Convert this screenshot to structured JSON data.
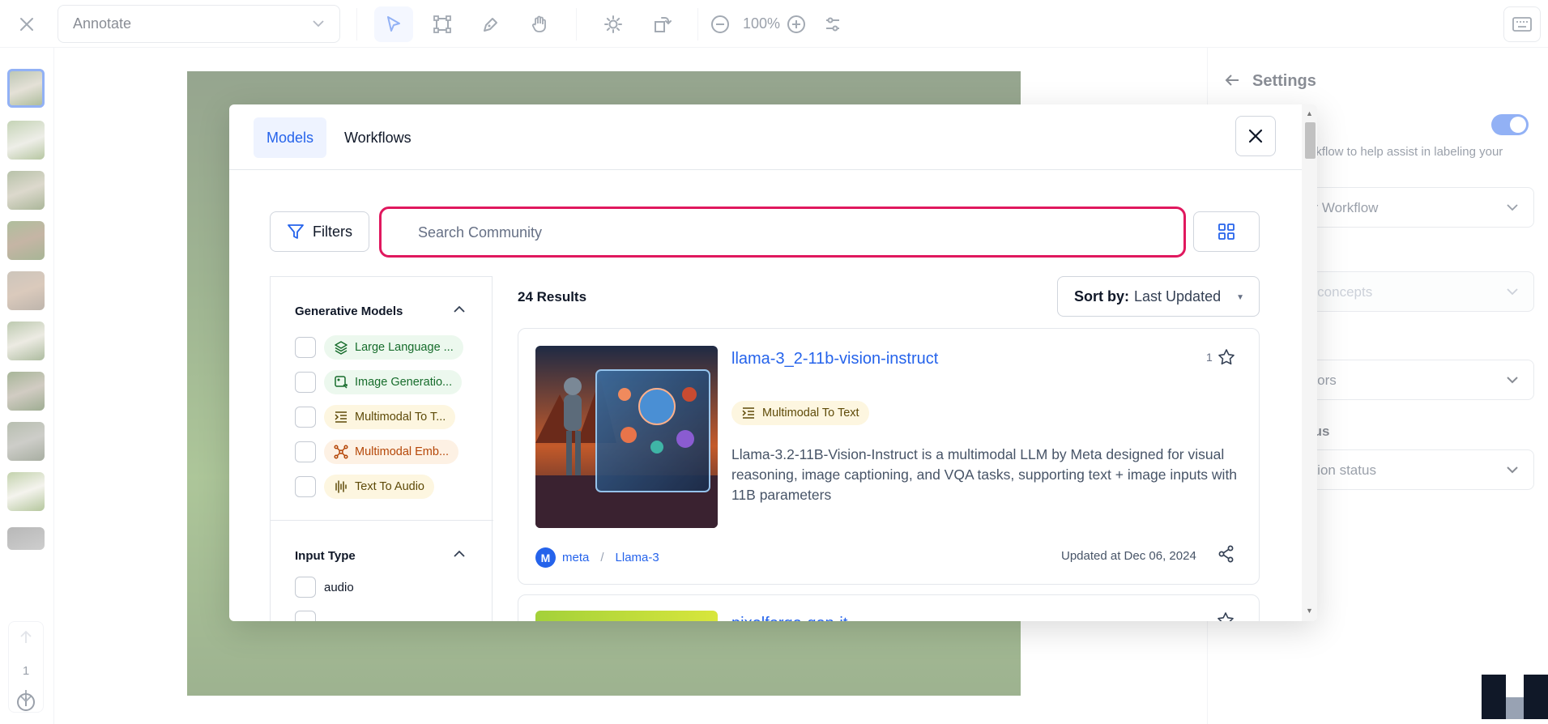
{
  "toolbar": {
    "mode_label": "Annotate",
    "zoom_level": "100%"
  },
  "leftbar": {
    "page_number": "1"
  },
  "settings": {
    "title": "Settings",
    "description": "orkflow to help assist in labeling your",
    "model_select": "or Workflow",
    "concepts_select": "d concepts",
    "annotators_select": "ators",
    "status_label": "tus",
    "status_select": "ation status"
  },
  "modal": {
    "tabs": [
      {
        "label": "Models",
        "active": true
      },
      {
        "label": "Workflows",
        "active": false
      }
    ],
    "filters_label": "Filters",
    "search": {
      "placeholder": "Search Community",
      "value": ""
    },
    "results_count": "24 Results",
    "sort": {
      "prefix": "Sort by:",
      "value": "Last Updated"
    },
    "filter_sections": [
      {
        "title": "Generative Models",
        "items": [
          {
            "label": "Large Language ...",
            "icon": "layers-icon",
            "color": "green"
          },
          {
            "label": "Image Generatio...",
            "icon": "image-gen-icon",
            "color": "green"
          },
          {
            "label": "Multimodal To T...",
            "icon": "list-indent-icon",
            "color": "yellow"
          },
          {
            "label": "Multimodal Emb...",
            "icon": "network-icon",
            "color": "orange"
          },
          {
            "label": "Text To Audio",
            "icon": "audio-wave-icon",
            "color": "yellow"
          }
        ]
      },
      {
        "title": "Input Type",
        "items": [
          {
            "label": "audio"
          }
        ]
      }
    ],
    "cards": [
      {
        "title": "llama-3_2-11b-vision-instruct",
        "star_count": "1",
        "tag": "Multimodal To Text",
        "description": "Llama-3.2-11B-Vision-Instruct is a multimodal LLM by Meta designed for visual reasoning, image captioning, and VQA tasks, supporting text + image inputs with 11B parameters",
        "owner_initial": "M",
        "owner": "meta",
        "app": "Llama-3",
        "updated": "Updated at Dec 06, 2024"
      },
      {
        "title": "pixelforge-gen-it"
      }
    ]
  },
  "colors": {
    "accent": "#2563eb",
    "search_highlight": "#e0185e"
  }
}
